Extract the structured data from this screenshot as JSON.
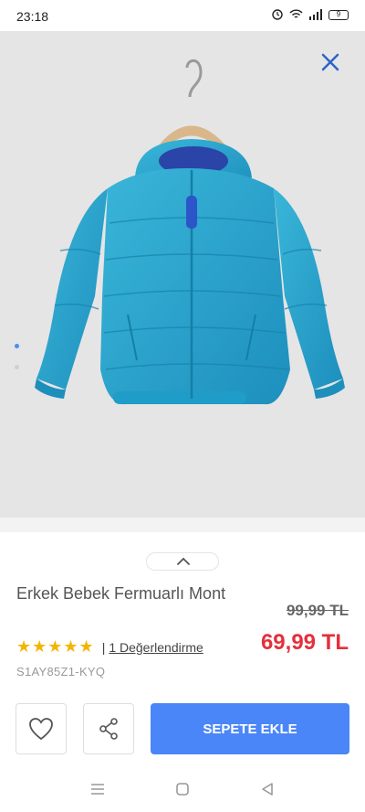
{
  "status_bar": {
    "time": "23:18",
    "battery": "9"
  },
  "gallery": {
    "image_alt": "Blue puffer jacket on hanger",
    "close_icon": "close-icon",
    "slide_count": 2,
    "active_slide": 0
  },
  "product": {
    "title": "Erkek Bebek Fermuarlı Mont",
    "old_price": "99,99 TL",
    "new_price": "69,99 TL",
    "rating_stars": 5,
    "stars": "★★★★★",
    "separator": "|",
    "reviews_label": "1 Değerlendirme",
    "sku": "S1AY85Z1-KYQ"
  },
  "actions": {
    "favorite_icon": "heart-icon",
    "share_icon": "share-icon",
    "add_to_cart_label": "SEPETE EKLE"
  },
  "colors": {
    "accent": "#4a86f7",
    "sale_price": "#e4303b",
    "star": "#f5b400"
  },
  "system_nav": {
    "items": [
      "menu-icon",
      "home-icon",
      "back-icon"
    ]
  }
}
